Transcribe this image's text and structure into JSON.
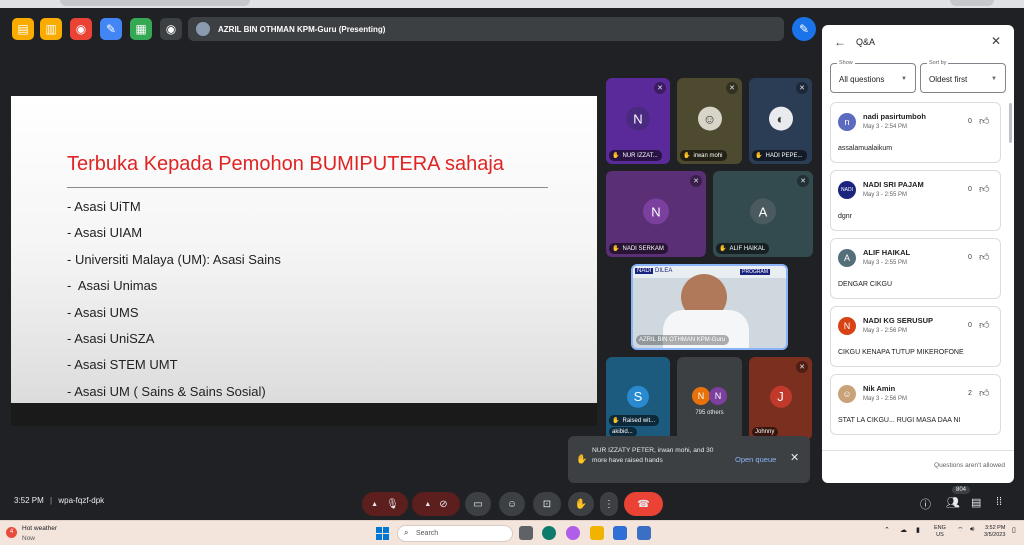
{
  "meeting": {
    "presenter_bar": "AZRIL BIN OTHMAN KPM-Guru (Presenting)",
    "time": "3:52 PM",
    "separator": "|",
    "code": "wpa-fqzf-dpk"
  },
  "slide": {
    "title": "Terbuka Kepada Pemohon BUMIPUTERA sahaja",
    "items": [
      "- Asasi UiTM",
      "- Asasi UIAM",
      "- Universiti Malaya (UM): Asasi Sains",
      "-  Asasi Unimas",
      "- Asasi UMS",
      "- Asasi UniSZA",
      "- Asasi STEM UMT",
      "- Asasi UM ( Sains & Sains Sosial)"
    ]
  },
  "tiles": [
    {
      "name": "NUR IZZAT...",
      "initial": "N",
      "color": "#5b2a9a"
    },
    {
      "name": "irwan mohi",
      "initial": "",
      "color": "#4e4a30"
    },
    {
      "name": "HADI PEPE...",
      "initial": "",
      "color": "#2b3c55"
    },
    {
      "name": "NADI SERKAM",
      "initial": "N",
      "color": "#5a2f76"
    },
    {
      "name": "ALIF HAIKAL",
      "initial": "A",
      "color": "#334b4e"
    },
    {
      "name": "AZRIL BIN OTHMAN KPM-Guru",
      "initial": "",
      "color": "#8a9ba8"
    },
    {
      "name": "Raised wit...",
      "initial": "S",
      "color": "#1c5a7e"
    },
    {
      "name": "795 others",
      "initial": "N",
      "color": "#3c4043"
    },
    {
      "name": "Johnny",
      "initial": "J",
      "color": "#7a2f1f"
    }
  ],
  "tile_sublabels": {
    "raised_name": "akibid...",
    "video_logo_left": "NADI",
    "video_logo_mid": "DILEA",
    "video_logo_right": "PROGRAM"
  },
  "queue": {
    "text": "NUR IZZATY PETER, irwan mohi, and 30 more have raised hands",
    "open_label": "Open queue"
  },
  "participants_badge": "804",
  "qa": {
    "title": "Q&A",
    "show_label": "Show",
    "show_value": "All questions",
    "sort_label": "Sort by",
    "sort_value": "Oldest first",
    "footer": "Questions aren't allowed",
    "questions": [
      {
        "name": "nadi pasirtumboh",
        "time": "May 3 - 2:54 PM",
        "text": "assalamualaikum",
        "votes": "0",
        "initial": "n",
        "color": "#5c6bc0"
      },
      {
        "name": "NADI SRI PAJAM",
        "time": "May 3 - 2:55 PM",
        "text": "dgnr",
        "votes": "0",
        "initial": "NADI",
        "color": "#1a237e"
      },
      {
        "name": "ALIF HAIKAL",
        "time": "May 3 - 2:55 PM",
        "text": "DENGAR CIKGU",
        "votes": "0",
        "initial": "A",
        "color": "#546e7a"
      },
      {
        "name": "NADI KG SERUSUP",
        "time": "May 3 - 2:56 PM",
        "text": "CIKGU KENAPA TUTUP MIKEROFONE",
        "votes": "0",
        "initial": "N",
        "color": "#d84315"
      },
      {
        "name": "Nik Amin",
        "time": "May 3 - 2:56 PM",
        "text": "STAT LA CIKGU... RUGI MASA DAA NI",
        "votes": "2",
        "initial": "",
        "color": "#c9a27a"
      }
    ]
  },
  "taskbar": {
    "weather_title": "Hot weather",
    "weather_sub": "Now",
    "weather_badge": "4",
    "search_placeholder": "Search",
    "lang_top": "ENG",
    "lang_bottom": "US",
    "time": "3:52 PM",
    "date": "3/5/2023"
  }
}
